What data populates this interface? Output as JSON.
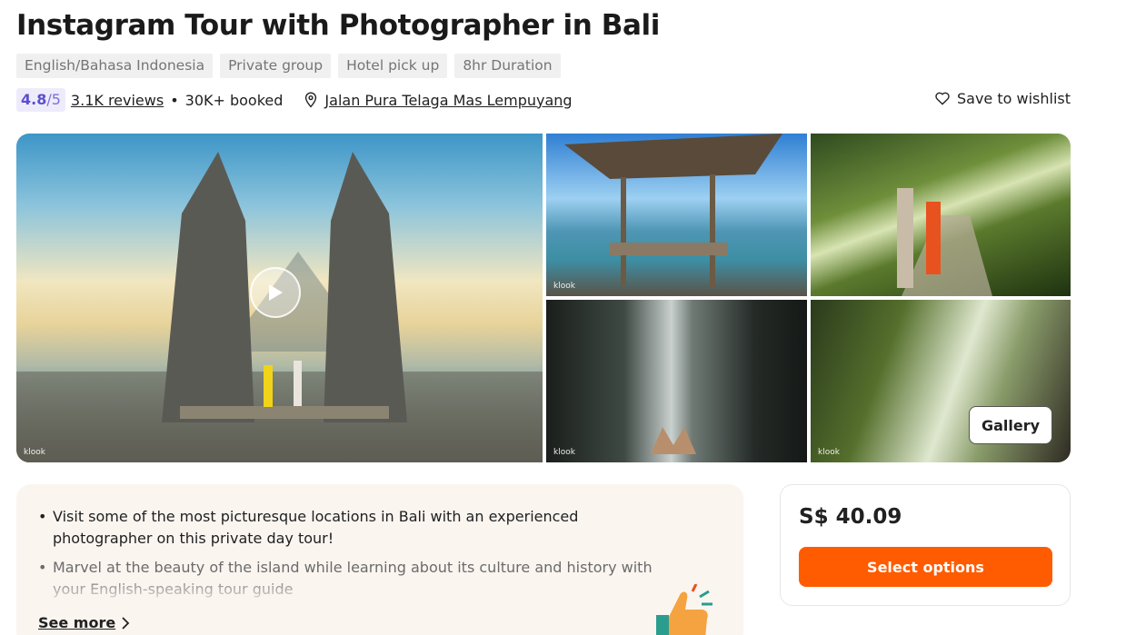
{
  "activity": {
    "title": "Instagram Tour with Photographer in Bali",
    "tags": [
      "English/Bahasa Indonesia",
      "Private group",
      "Hotel pick up",
      "8hr Duration"
    ],
    "rating": "4.8",
    "rating_out_of": "/5",
    "reviews": "3.1K reviews",
    "separator": "•",
    "booked": "30K+ booked",
    "location": "Jalan Pura Telaga Mas Lempuyang",
    "wishlist_label": "Save to wishlist"
  },
  "gallery": {
    "watermark": "klook",
    "button_label": "Gallery"
  },
  "highlights": {
    "items": [
      "Visit some of the most picturesque locations in Bali with an experienced photographer on this private day tour!",
      "Marvel at the beauty of the island while learning about its culture and history with your English-speaking tour guide"
    ],
    "see_more": "See more"
  },
  "booking": {
    "price": "S$ 40.09",
    "select_label": "Select options"
  },
  "colors": {
    "accent": "#ff5b00",
    "rating": "#5b4fcf",
    "tag_bg": "#f0f0f0",
    "highlights_bg": "#fbf5f0"
  }
}
